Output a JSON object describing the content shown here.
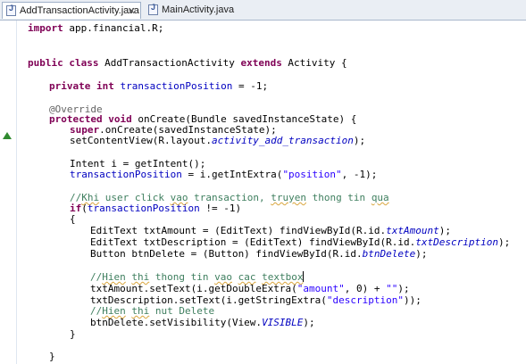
{
  "tabs": [
    {
      "label": "AddTransactionActivity.java",
      "active": true
    },
    {
      "label": "MainActivity.java",
      "active": false
    }
  ],
  "code": {
    "import": [
      "import ",
      "app.financial.R;"
    ],
    "classdecl": [
      "public",
      " ",
      "class",
      " AddTransactionActivity ",
      "extends",
      " Activity {"
    ],
    "field": [
      "private",
      " ",
      "int",
      " ",
      "transactionPosition",
      " = -1;"
    ],
    "annotation": "@Override",
    "oncreate": [
      "protected",
      " ",
      "void",
      " onCreate(Bundle savedInstanceState) {"
    ],
    "super": [
      "super",
      ".onCreate(savedInstanceState);"
    ],
    "setcontent": [
      "setContentView(R.layout.",
      "activity_add_transaction",
      ");"
    ],
    "intent": "Intent i = getIntent();",
    "getextra": [
      "transactionPosition",
      " = i.getIntExtra(",
      "\"position\"",
      ", -1);"
    ],
    "comment1": [
      "//",
      "Khi",
      " user click ",
      "vao",
      " transaction, ",
      "truyen",
      " thong tin ",
      "qua"
    ],
    "iff": [
      "if",
      "(",
      "transactionPosition",
      " != -1)"
    ],
    "open": "{",
    "txtamount": [
      "EditText txtAmount = (EditText) findViewById(R.id.",
      "txtAmount",
      ");"
    ],
    "txtdesc": [
      "EditText txtDescription = (EditText) findViewById(R.id.",
      "txtDescription",
      ");"
    ],
    "btndelete": [
      "Button btnDelete = (Button) findViewById(R.id.",
      "btnDelete",
      ");"
    ],
    "comment2": [
      "//",
      "Hien",
      " ",
      "thi",
      " thong tin ",
      "vao",
      " ",
      "cac",
      " ",
      "textbox"
    ],
    "setamount": [
      "txtAmount.setText(i.getDoubleExtra(",
      "\"amount\"",
      ", 0) + ",
      "\"\"",
      ");"
    ],
    "setdesc": [
      "txtDescription.setText(i.getStringExtra(",
      "\"description\"",
      "));"
    ],
    "comment3": [
      "//",
      "Hien",
      " ",
      "thi",
      " nut Delete"
    ],
    "setvis": [
      "btnDelete.setVisibility(View.",
      "VISIBLE",
      ");"
    ],
    "close": "}"
  }
}
